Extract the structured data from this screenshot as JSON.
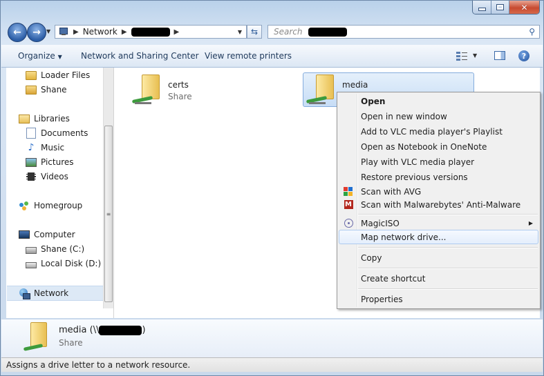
{
  "window": {
    "minimize_icon": "minimize-icon",
    "maximize_icon": "maximize-icon",
    "close_icon": "close-icon"
  },
  "address_bar": {
    "crumbs": [
      "Network"
    ],
    "search_placeholder": "Search"
  },
  "toolbar": {
    "organize_label": "Organize",
    "network_sharing_label": "Network and Sharing Center",
    "remote_printers_label": "View remote printers"
  },
  "nav": {
    "items": [
      {
        "label": "Loader Files",
        "icon": "folder-icon"
      },
      {
        "label": "Shane",
        "icon": "user-folder-icon"
      },
      {
        "label": "Libraries",
        "icon": "libraries-icon"
      },
      {
        "label": "Documents",
        "icon": "documents-icon"
      },
      {
        "label": "Music",
        "icon": "music-icon"
      },
      {
        "label": "Pictures",
        "icon": "pictures-icon"
      },
      {
        "label": "Videos",
        "icon": "videos-icon"
      },
      {
        "label": "Homegroup",
        "icon": "homegroup-icon"
      },
      {
        "label": "Computer",
        "icon": "computer-icon"
      },
      {
        "label": "Shane (C:)",
        "icon": "drive-c-icon"
      },
      {
        "label": "Local Disk (D:)",
        "icon": "drive-d-icon"
      },
      {
        "label": "Network",
        "icon": "network-icon"
      }
    ]
  },
  "shares": [
    {
      "name": "certs",
      "type": "Share"
    },
    {
      "name": "media",
      "type": ""
    }
  ],
  "context_menu": {
    "items": [
      "Open",
      "Open in new window",
      "Add to VLC media player's Playlist",
      "Open as Notebook in OneNote",
      "Play with VLC media player",
      "Restore previous versions",
      "Scan with AVG",
      "Scan with Malwarebytes' Anti-Malware",
      "MagicISO",
      "Map network drive...",
      "Copy",
      "Create shortcut",
      "Properties"
    ]
  },
  "details": {
    "name_prefix": "media (\\\\",
    "name_suffix": ")",
    "type": "Share"
  },
  "status": {
    "text": "Assigns a drive letter to a network resource."
  }
}
